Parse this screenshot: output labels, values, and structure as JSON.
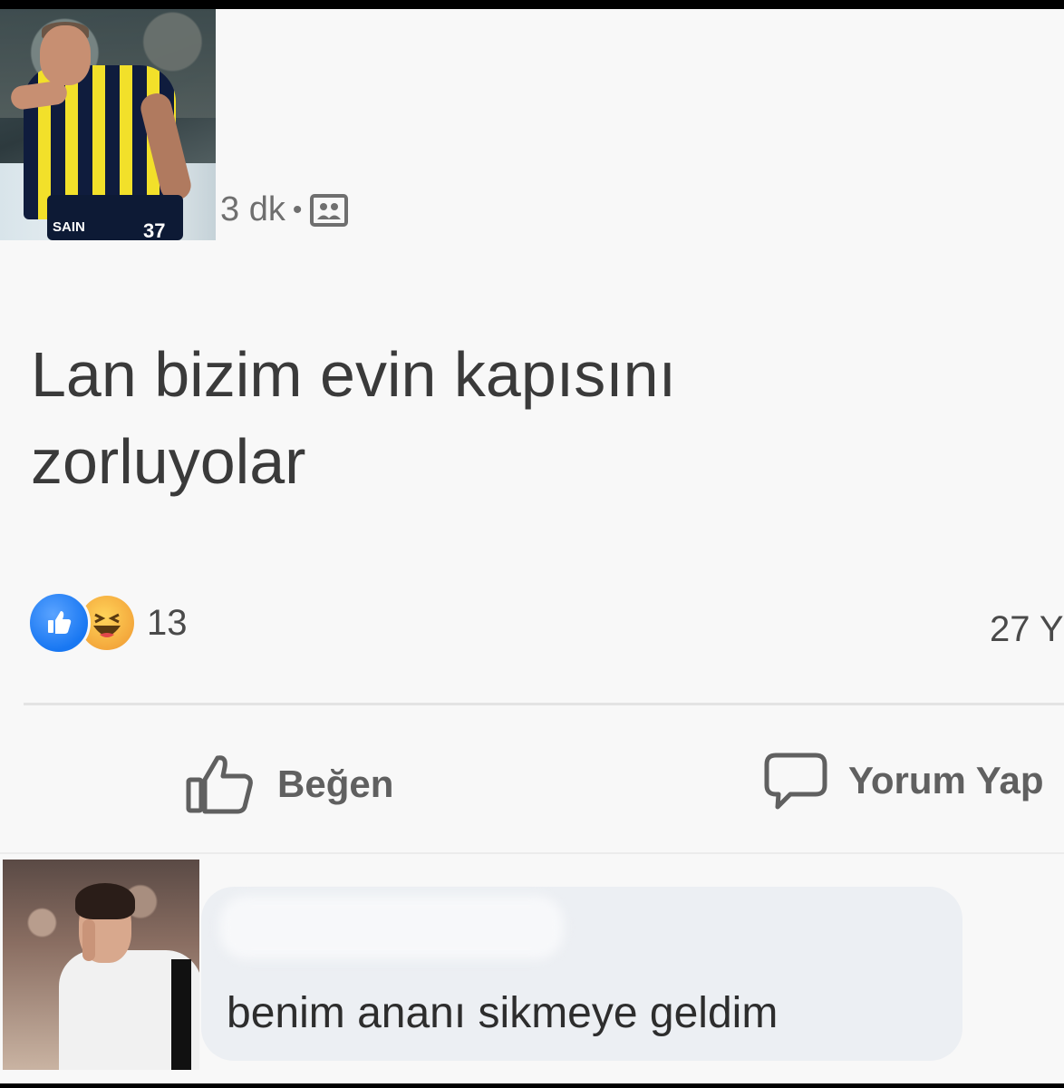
{
  "post": {
    "author_avatar": "player-photo-yellow-navy-striped-kit",
    "time": "3 dk",
    "separator": "•",
    "audience_icon": "friends-icon",
    "text_line1": "Lan bizim evin kapısını",
    "text_line2": "zorluyolar",
    "avatar_jersey_number": "37",
    "avatar_sponsor": "SAIN"
  },
  "reactions": {
    "icons": [
      "like-reaction-icon",
      "haha-reaction-icon"
    ],
    "count": "13",
    "comment_count": "27 Y",
    "like_color": "#1877f2",
    "haha_color": "#f3a53a"
  },
  "actions": {
    "like_label": "Beğen",
    "comment_label": "Yorum Yap"
  },
  "comment": {
    "author_avatar": "player-photo-white-kit-shush",
    "text": "benim ananı sikmeye geldim"
  }
}
